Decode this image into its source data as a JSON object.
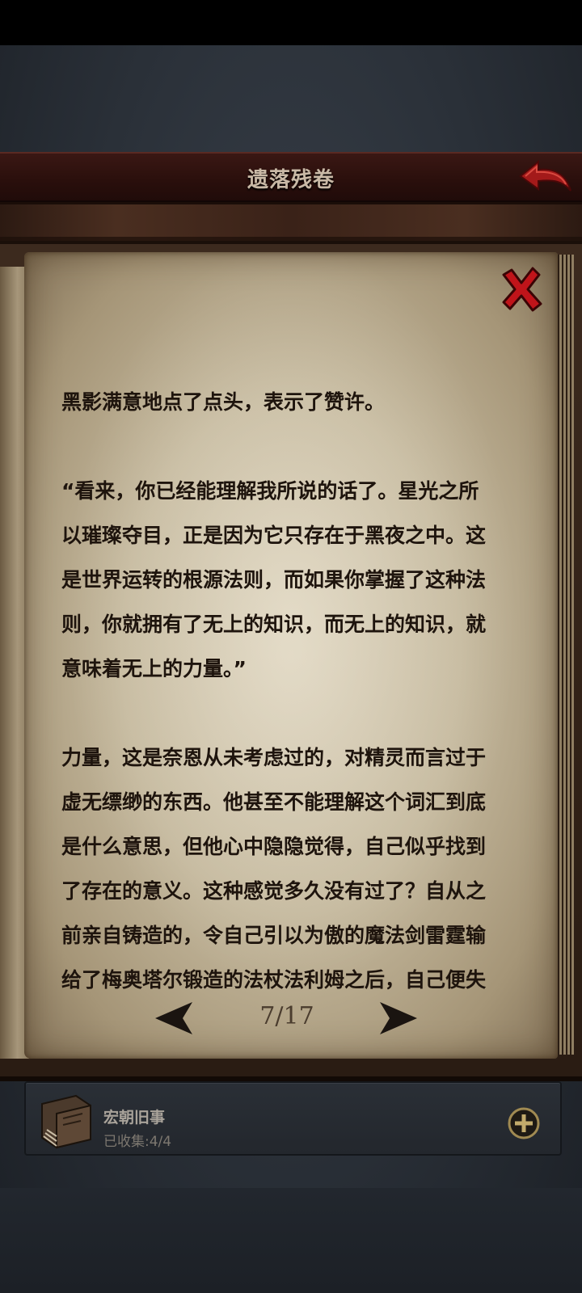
{
  "header": {
    "title": "遗落残卷",
    "back_icon": "back-arrow-icon"
  },
  "book": {
    "close_icon": "close-x-icon",
    "paragraphs": [
      [
        "黑影满意地点了点头，表示了赞许。"
      ],
      [
        "“看来，你已经能理解我所说的话了。星光之所",
        "以璀璨夺目，正是因为它只存在于黑夜之中。这",
        "是世界运转的根源法则，而如果你掌握了这种法",
        "则，你就拥有了无上的知识，而无上的知识，就",
        "意味着无上的力量。”"
      ],
      [
        "力量，这是奈恩从未考虑过的，对精灵而言过于",
        "虚无缥缈的东西。他甚至不能理解这个词汇到底",
        "是什么意思，但他心中隐隐觉得，自己似乎找到",
        "了存在的意义。这种感觉多久没有过了？自从之",
        "前亲自铸造的，令自己引以为傲的魔法剑雷霆输",
        "给了梅奥塔尔锻造的法杖法利姆之后，自己便失"
      ]
    ]
  },
  "pager": {
    "current": 7,
    "total": 17,
    "label": "7/17",
    "prev_icon": "left-arrow-icon",
    "next_icon": "right-arrow-icon"
  },
  "collection": {
    "name": "宏朝旧事",
    "count_label": "已收集:4/4",
    "icon": "book-icon",
    "expand_icon": "plus-circle-icon"
  },
  "colors": {
    "title_bar": "#2a0f0c",
    "parchment": "#c4b89d",
    "text": "#1e140d",
    "close_red": "#c0141a"
  }
}
